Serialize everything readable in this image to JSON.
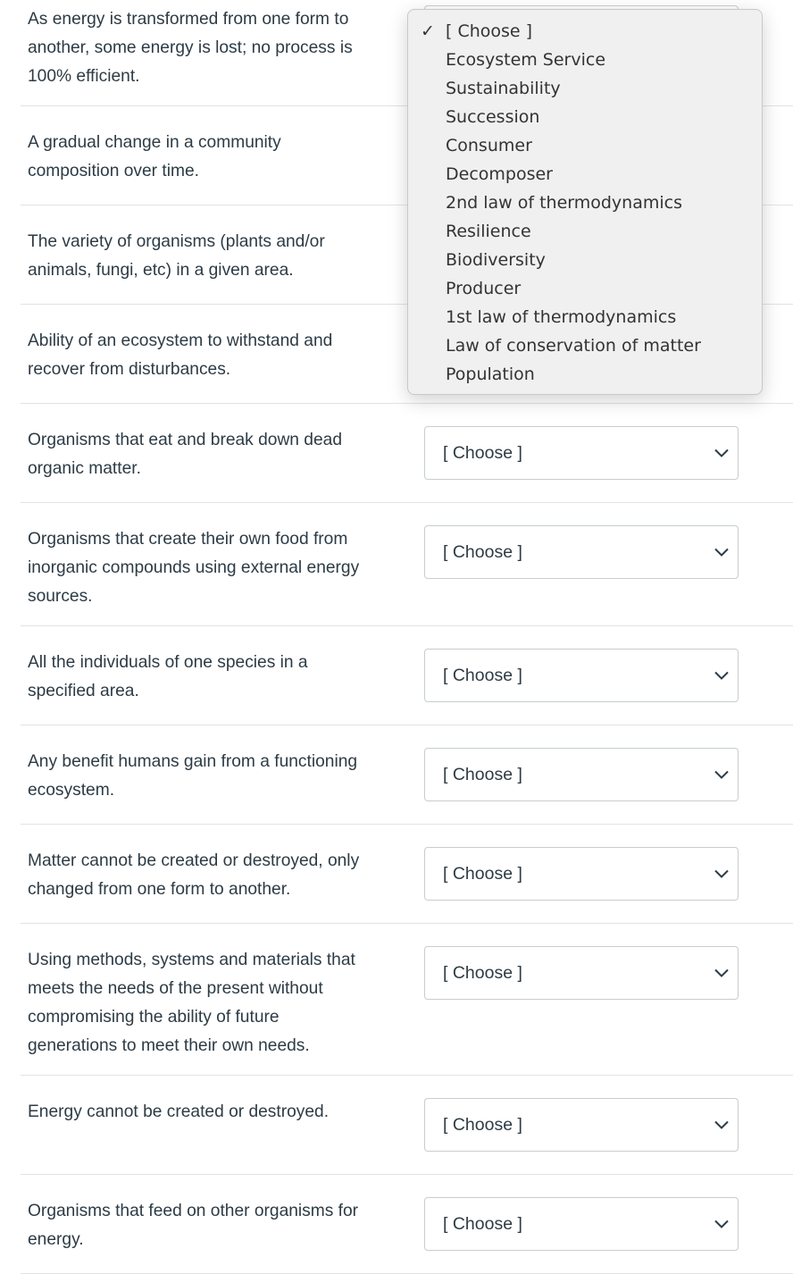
{
  "questions": [
    {
      "text": "As energy is transformed from one form to\nanother, some energy is lost; no process is\n100% efficient.",
      "selected": "[ Choose ]"
    },
    {
      "text": "A gradual change in a community\ncomposition over time.",
      "selected": "[ Choose ]"
    },
    {
      "text": "The variety of organisms (plants and/or\nanimals, fungi, etc) in a given area.",
      "selected": "[ Choose ]"
    },
    {
      "text": "Ability of an ecosystem to withstand and\nrecover from disturbances.",
      "selected": "[ Choose ]"
    },
    {
      "text": "Organisms that eat and break down dead\norganic matter.",
      "selected": "[ Choose ]"
    },
    {
      "text": "Organisms that create their own food from\ninorganic compounds using external energy\nsources.",
      "selected": "[ Choose ]"
    },
    {
      "text": "All the individuals of one species in a\nspecified area.",
      "selected": "[ Choose ]"
    },
    {
      "text": "Any benefit humans gain from a functioning\necosystem.",
      "selected": "[ Choose ]"
    },
    {
      "text": "Matter cannot be created or destroyed, only\nchanged from one form to another.",
      "selected": "[ Choose ]"
    },
    {
      "text": "Using methods, systems and materials that\nmeets the needs of the present without\ncompromising the ability of future\ngenerations to meet their own needs.",
      "selected": "[ Choose ]"
    },
    {
      "text": "Energy cannot be created or destroyed.",
      "selected": "[ Choose ]"
    },
    {
      "text": "Organisms that feed on other organisms for\nenergy.",
      "selected": "[ Choose ]"
    }
  ],
  "dropdown": {
    "check_icon": "✓",
    "options": [
      "[ Choose ]",
      "Ecosystem Service",
      "Sustainability",
      "Succession",
      "Consumer",
      "Decomposer",
      "2nd law of thermodynamics",
      "Resilience",
      "Biodiversity",
      "Producer",
      "1st law of thermodynamics",
      "Law of conservation of matter",
      "Population"
    ],
    "selected_index": 0
  },
  "colors": {
    "text": "#2d3b45",
    "divider": "#e2e2e2",
    "popup_bg": "#f0f0f0"
  }
}
